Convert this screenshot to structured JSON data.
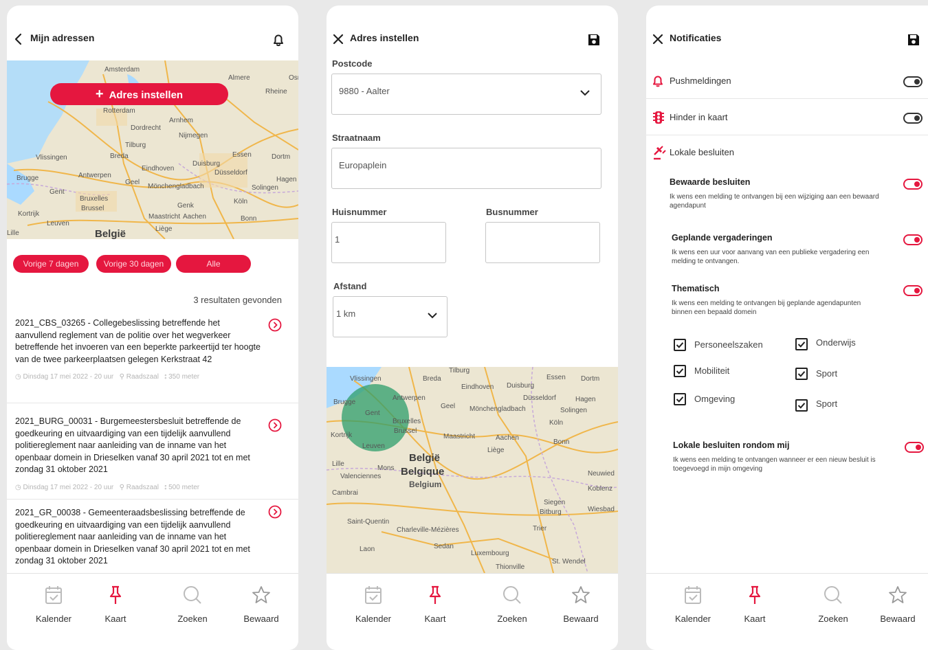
{
  "colors": {
    "accent": "#e5173f",
    "text": "#222222",
    "muted": "#b5b5b5"
  },
  "screen1": {
    "title": "Mijn adressen",
    "back_icon": "chevron-left-icon",
    "bell_icon": "bell-icon",
    "add_button_label": "Adres instellen",
    "map_labels": [
      "Amsterdam",
      "Almere",
      "Rotterdam",
      "Arnhem",
      "Nijmegen",
      "Dordrecht",
      "Tilburg",
      "Breda",
      "Vlissingen",
      "Eindhoven",
      "Duisburg",
      "Essen",
      "Dortm",
      "Antwerpen",
      "Brugge",
      "Gent",
      "Bruxelles",
      "Brussel",
      "Kortrijk",
      "Maastricht",
      "Aachen",
      "Köln",
      "Bonn",
      "Liège",
      "Düsseldorf",
      "Mönchengladbach",
      "Solingen",
      "Hagen",
      "Geel",
      "Genk",
      "Leuven",
      "Osn",
      "Rheine",
      "Lille"
    ],
    "map_big_label": "België",
    "filters": [
      "Vorige 7 dagen",
      "Vorige 30 dagen",
      "Alle"
    ],
    "result_count": "3 resultaten gevonden",
    "results": [
      {
        "text": "2021_CBS_03265 - Collegebeslissing betreffende het aanvullend reglement van de politie over het wegverkeer betreffende het invoeren van een beperkte parkeertijd ter hoogte van de twee parkeerplaatsen gelegen Kerkstraat 42",
        "date": "Dinsdag 17 mei 2022 - 20 uur",
        "location": "Raadszaal",
        "distance": "350 meter"
      },
      {
        "text": "2021_BURG_00031 - Burgemeestersbesluit betreffende de goedkeuring en uitvaardiging van een tijdelijk aanvullend politiereglement naar aanleiding van de inname van het openbaar domein in Drieselken vanaf 30 april 2021 tot en met zondag 31 oktober 2021",
        "date": "Dinsdag 17 mei 2022 - 20 uur",
        "location": "Raadszaal",
        "distance": "500 meter"
      },
      {
        "text": "2021_GR_00038 - Gemeenteraadsbeslissing betreffende de goedkeuring en uitvaardiging van een tijdelijk aanvullend politiereglement naar aanleiding van de inname van het openbaar domein in Drieselken vanaf 30 april 2021 tot en met zondag 31 oktober 2021",
        "date": "",
        "location": "",
        "distance": ""
      }
    ]
  },
  "screen2": {
    "title": "Adres instellen",
    "close_icon": "close-icon",
    "save_icon": "save-icon",
    "postcode_label": "Postcode",
    "postcode_value": "9880 - Aalter",
    "street_label": "Straatnaam",
    "street_value": "Europaplein",
    "house_label": "Huisnummer",
    "house_value": "1",
    "bus_label": "Busnummer",
    "bus_value": "",
    "distance_label": "Afstand",
    "distance_value": "1 km",
    "map_labels": [
      "Vlissingen",
      "Breda",
      "Tilburg",
      "Eindhoven",
      "Duisburg",
      "Essen",
      "Dortm",
      "Düsseldorf",
      "Antwerpen",
      "Brugge",
      "Gent",
      "Geel",
      "Mönchengladbach",
      "Hagen",
      "Solingen",
      "Kortrijk",
      "Bruxelles",
      "Brussel",
      "Maastricht",
      "Aachen",
      "Köln",
      "Bonn",
      "Lille",
      "Leuven",
      "Liège",
      "Mons",
      "Valenciennes",
      "Cambrai",
      "Saint-Quentin",
      "Charleville-Mézières",
      "Sedan",
      "Laon",
      "Trier",
      "Luxembourg",
      "Thionville",
      "St. Wendel",
      "Koblenz",
      "Wiesbad",
      "Neuwied",
      "Bitburg",
      "Siegen"
    ],
    "map_big_labels": [
      "België",
      "Belgique",
      "Belgium"
    ]
  },
  "screen3": {
    "title": "Notificaties",
    "close_icon": "close-icon",
    "save_icon": "save-icon",
    "rows": [
      {
        "label": "Pushmeldingen",
        "icon": "bell-icon",
        "on": false
      },
      {
        "label": "Hinder in kaart",
        "icon": "traffic-light-icon",
        "on": false
      },
      {
        "label": "Lokale besluiten",
        "icon": "gavel-icon"
      }
    ],
    "subsettings": [
      {
        "title": "Bewaarde besluiten",
        "desc": "Ik wens een melding te ontvangen bij een wijziging aan een bewaard agendapunt",
        "on": true
      },
      {
        "title": "Geplande vergaderingen",
        "desc": "Ik wens een uur voor aanvang van een publieke vergadering een melding te ontvangen.",
        "on": true
      },
      {
        "title": "Thematisch",
        "desc": "Ik wens een melding te ontvangen bij geplande agendapunten binnen een bepaald domein",
        "on": true
      }
    ],
    "themes": [
      {
        "label": "Personeelszaken",
        "checked": true
      },
      {
        "label": "Onderwijs",
        "checked": true
      },
      {
        "label": "Mobiliteit",
        "checked": true
      },
      {
        "label": "Sport",
        "checked": true
      },
      {
        "label": "Omgeving",
        "checked": true
      },
      {
        "label": "Sport",
        "checked": true
      }
    ],
    "nearby": {
      "title": "Lokale besluiten rondom mij",
      "desc": "Ik wens een melding te ontvangen wanneer er een nieuw besluit is toegevoegd in mijn omgeving",
      "on": true
    }
  },
  "navbar": [
    {
      "label": "Kalender",
      "icon": "calendar-icon"
    },
    {
      "label": "Kaart",
      "icon": "pin-icon",
      "active": true
    },
    {
      "label": "Zoeken",
      "icon": "search-icon"
    },
    {
      "label": "Bewaard",
      "icon": "star-icon"
    }
  ]
}
